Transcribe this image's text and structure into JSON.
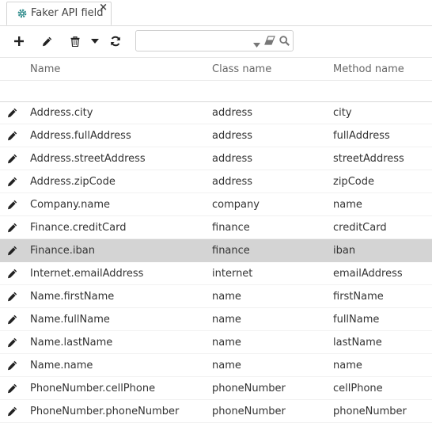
{
  "tab": {
    "label": "Faker API field",
    "close": "×"
  },
  "toolbar": {
    "search": {
      "value": "",
      "placeholder": ""
    }
  },
  "columns": {
    "name": "Name",
    "class_name": "Class name",
    "method_name": "Method name"
  },
  "rows": [
    {
      "name": "Address.city",
      "class_name": "address",
      "method_name": "city"
    },
    {
      "name": "Address.fullAddress",
      "class_name": "address",
      "method_name": "fullAddress"
    },
    {
      "name": "Address.streetAddress",
      "class_name": "address",
      "method_name": "streetAddress"
    },
    {
      "name": "Address.zipCode",
      "class_name": "address",
      "method_name": "zipCode"
    },
    {
      "name": "Company.name",
      "class_name": "company",
      "method_name": "name"
    },
    {
      "name": "Finance.creditCard",
      "class_name": "finance",
      "method_name": "creditCard"
    },
    {
      "name": "Finance.iban",
      "class_name": "finance",
      "method_name": "iban",
      "selected": true
    },
    {
      "name": "Internet.emailAddress",
      "class_name": "internet",
      "method_name": "emailAddress"
    },
    {
      "name": "Name.firstName",
      "class_name": "name",
      "method_name": "firstName"
    },
    {
      "name": "Name.fullName",
      "class_name": "name",
      "method_name": "fullName"
    },
    {
      "name": "Name.lastName",
      "class_name": "name",
      "method_name": "lastName"
    },
    {
      "name": "Name.name",
      "class_name": "name",
      "method_name": "name"
    },
    {
      "name": "PhoneNumber.cellPhone",
      "class_name": "phoneNumber",
      "method_name": "cellPhone"
    },
    {
      "name": "PhoneNumber.phoneNumber",
      "class_name": "phoneNumber",
      "method_name": "phoneNumber"
    }
  ],
  "colors": {
    "accent": "#2e8b8b",
    "selected_row": "#d4d4d4",
    "icon": "#333333"
  }
}
